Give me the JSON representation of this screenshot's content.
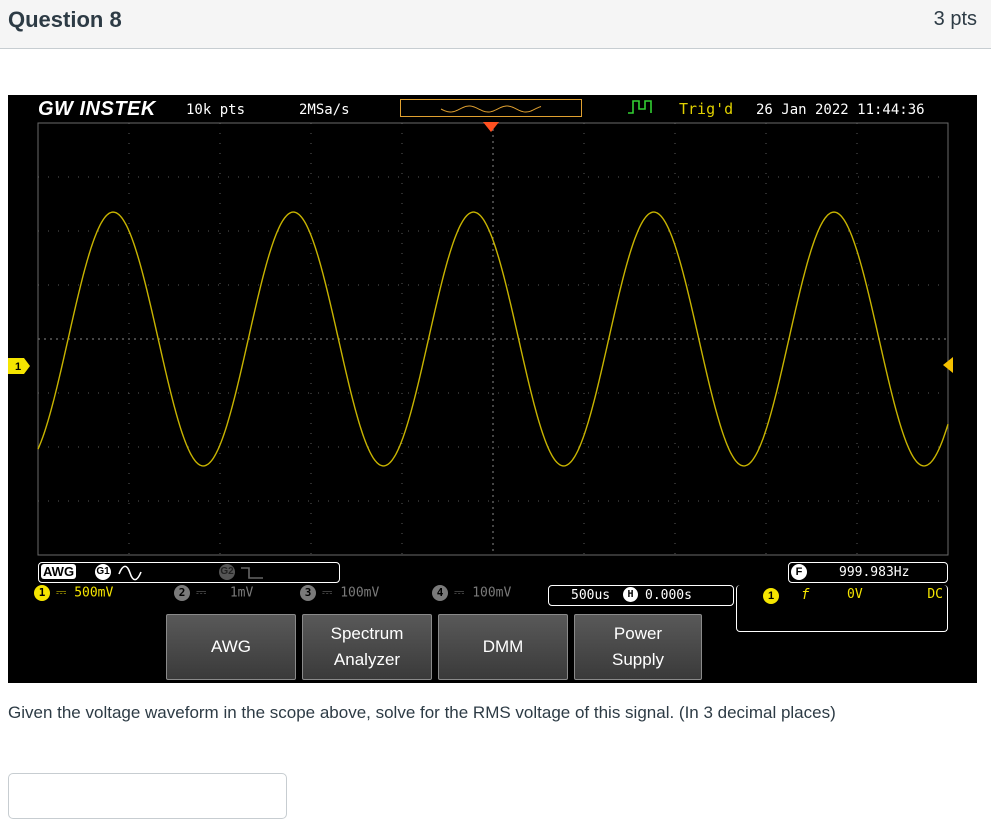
{
  "question": {
    "title": "Question 8",
    "points": "3 pts",
    "prompt": "Given the voltage waveform in the scope above, solve for the RMS voltage of this signal. (In 3 decimal places)",
    "answer_value": "",
    "answer_placeholder": ""
  },
  "scope": {
    "brand": "GW INSTEK",
    "record_length": "10k pts",
    "sample_rate": "2MSa/s",
    "trigger_status": "Trig'd",
    "datetime": "26 Jan 2022 11:44:36",
    "awg": {
      "label": "AWG",
      "g1": "G1",
      "g2": "G2"
    },
    "channels": [
      {
        "num": "1",
        "coupling": "⎓",
        "scale": "500mV",
        "color": "#f5e500"
      },
      {
        "num": "2",
        "coupling": "⎓",
        "scale": "1mV",
        "color": "#7a7a7a"
      },
      {
        "num": "3",
        "coupling": "⎓",
        "scale": "100mV",
        "color": "#7a7a7a"
      },
      {
        "num": "4",
        "coupling": "⎓",
        "scale": "100mV",
        "color": "#7a7a7a"
      }
    ],
    "timebase": {
      "scale": "500us",
      "h_icon": "H",
      "position": "0.000s"
    },
    "frequency": {
      "label": "F",
      "value": "999.983Hz"
    },
    "trigger": {
      "source": "1",
      "slope": "f",
      "level": "0V",
      "coupling": "DC"
    },
    "ch1_marker": "1",
    "softkeys": [
      {
        "label": "AWG"
      },
      {
        "label": "Spectrum Analyzer"
      },
      {
        "label": "DMM"
      },
      {
        "label": "Power Supply"
      }
    ],
    "colors": {
      "ch1": "#c8b400",
      "background": "#000000",
      "accent": "#e0a030"
    }
  }
}
